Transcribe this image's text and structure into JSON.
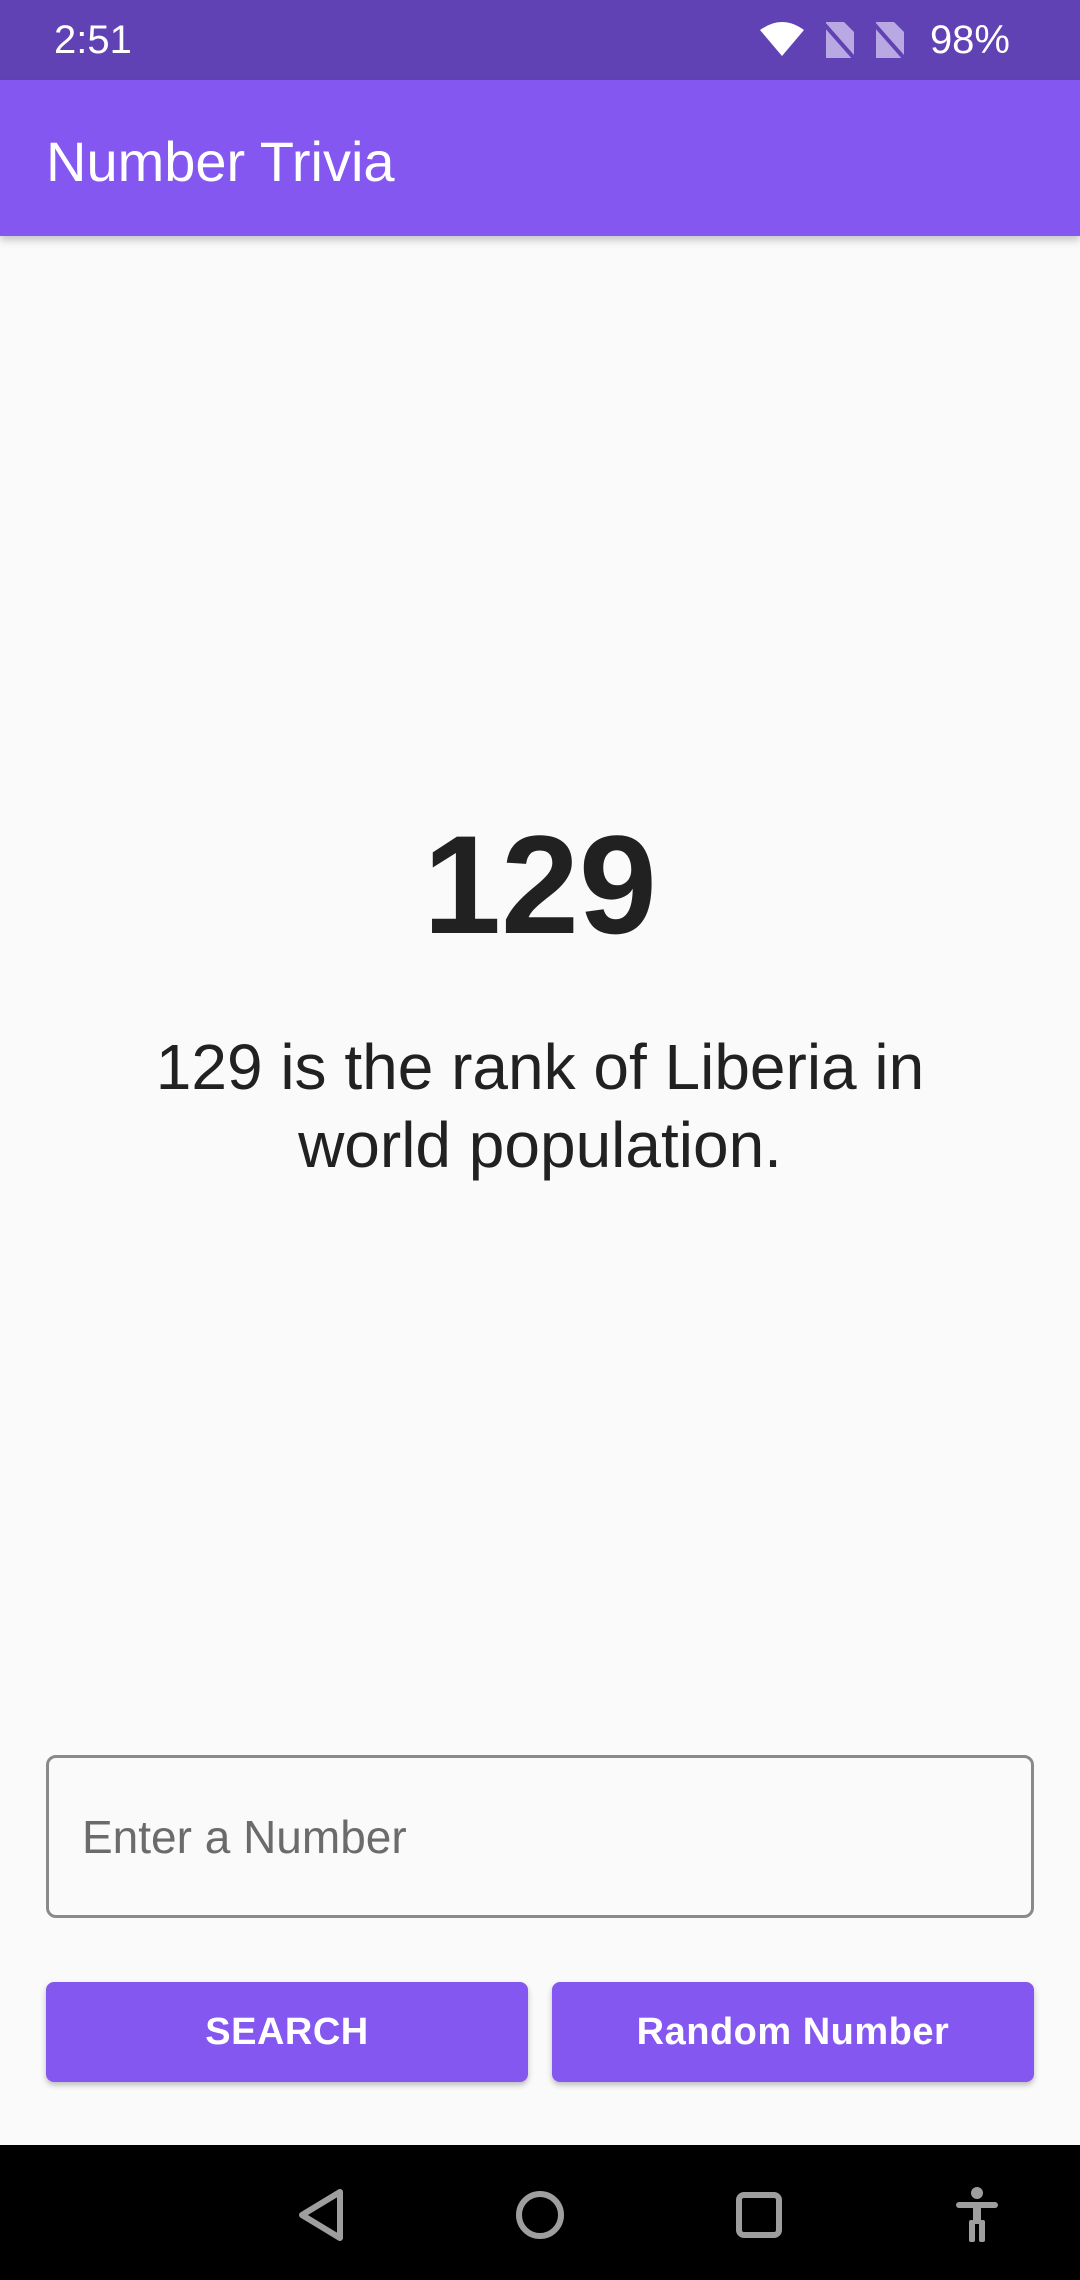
{
  "status_bar": {
    "time": "2:51",
    "battery": "98%",
    "icons": [
      "wifi-icon",
      "no-sim-icon",
      "no-sim-icon",
      "battery-icon"
    ]
  },
  "app_bar": {
    "title": "Number Trivia"
  },
  "trivia": {
    "number": "129",
    "text": "129 is the rank of Liberia in world population."
  },
  "input": {
    "placeholder": "Enter a Number",
    "value": ""
  },
  "buttons": {
    "search_label": "SEARCH",
    "random_label": "Random Number"
  },
  "nav_bar": {
    "icons": [
      "back-icon",
      "home-icon",
      "recents-icon",
      "accessibility-icon"
    ]
  },
  "colors": {
    "status_bar": "#6142b5",
    "primary": "#8457f0",
    "background": "#fafafa",
    "text": "#212121"
  }
}
